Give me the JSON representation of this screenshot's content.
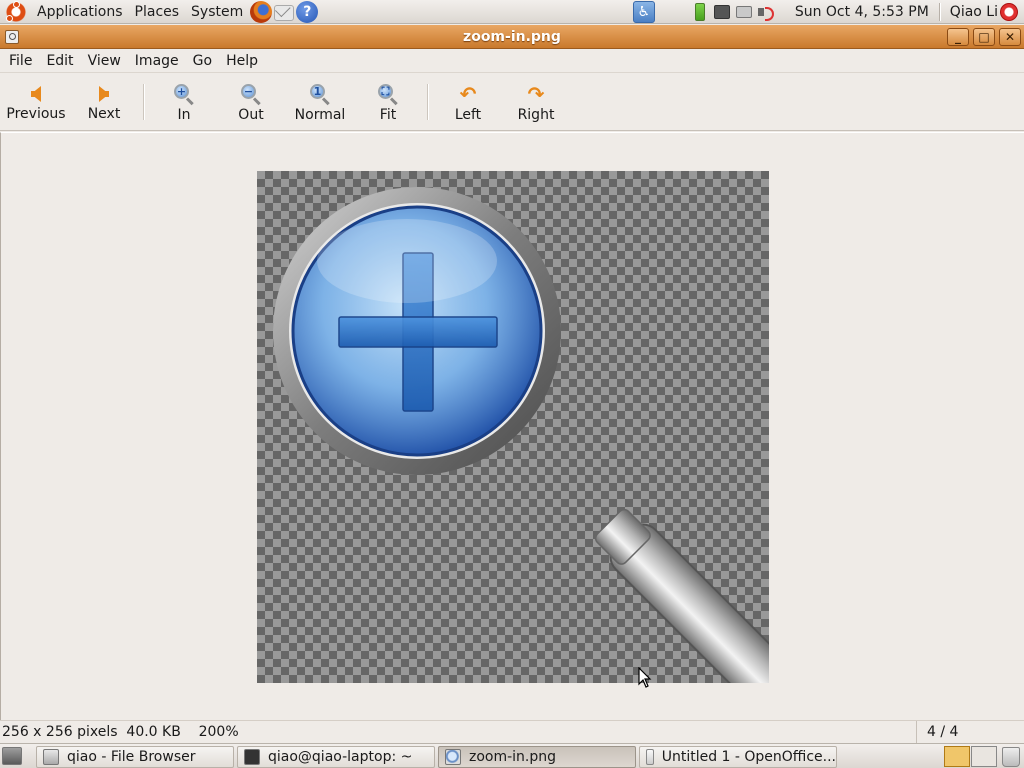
{
  "top_panel": {
    "menus": [
      "Applications",
      "Places",
      "System"
    ],
    "clock": "Sun Oct  4,  5:53 PM",
    "user": "Qiao Li",
    "icons": [
      "ubuntu-logo",
      "firefox-icon",
      "mail-icon",
      "help-icon",
      "accessibility-icon",
      "battery-icon",
      "network-icon",
      "printer-icon",
      "volume-icon",
      "power-icon"
    ]
  },
  "window": {
    "title": "zoom-in.png",
    "controls": [
      "minimize",
      "maximize",
      "close"
    ]
  },
  "menubar": {
    "items": [
      "File",
      "Edit",
      "View",
      "Image",
      "Go",
      "Help"
    ]
  },
  "toolbar": {
    "previous": "Previous",
    "next": "Next",
    "zoom_in": "In",
    "zoom_out": "Out",
    "normal": "Normal",
    "fit": "Fit",
    "rotate_left": "Left",
    "rotate_right": "Right"
  },
  "image": {
    "description_icon": "zoom-in magnifier with plus sign",
    "accent_color": "#3a7bd5"
  },
  "statusbar": {
    "info": "256 x 256 pixels  40.0 KB    200%",
    "page": "4 / 4"
  },
  "taskbar": {
    "tasks": [
      {
        "label": "qiao - File Browser",
        "active": false
      },
      {
        "label": "qiao@qiao-laptop: ~",
        "active": false
      },
      {
        "label": "zoom-in.png",
        "active": true
      },
      {
        "label": "Untitled 1 - OpenOffice...",
        "active": false
      }
    ]
  },
  "colors": {
    "titlebar": "#d58a3e",
    "panel": "#e6e2dd",
    "accent_orange": "#e8891c"
  }
}
